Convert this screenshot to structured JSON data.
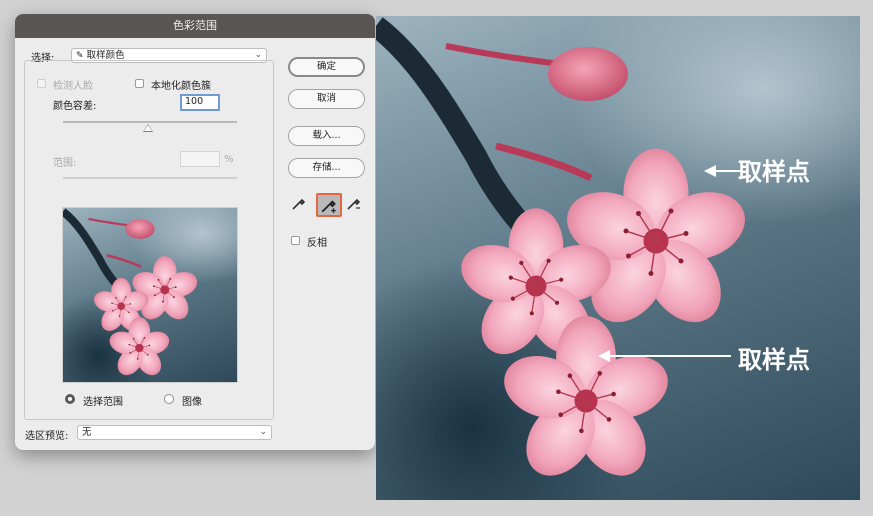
{
  "dialog": {
    "title": "色彩范围",
    "select_label": "选择:",
    "select_value": "取样颜色",
    "detect_faces_label": "检测人脸",
    "localized_clusters_label": "本地化颜色簇",
    "fuzziness_label": "颜色容差:",
    "fuzziness_value": "100",
    "fuzziness_slider_fraction": 0.49,
    "range_label": "范围:",
    "range_unit": "%",
    "view_selection_label": "选择范围",
    "view_image_label": "图像",
    "preview_label": "选区预览:",
    "preview_value": "无"
  },
  "buttons": {
    "ok": "确定",
    "cancel": "取消",
    "load": "载入...",
    "save": "存储..."
  },
  "tools": [
    {
      "icon": "eyedropper-icon"
    },
    {
      "icon": "eyedropper-plus-icon",
      "active": true
    },
    {
      "icon": "eyedropper-minus-icon"
    }
  ],
  "invert_label": "反相",
  "annotations": [
    "取样点",
    "取样点"
  ],
  "colors": {
    "accent_active_tool": "#e2683f",
    "titlebar": "#585553",
    "focus": "#6d9bd5"
  }
}
